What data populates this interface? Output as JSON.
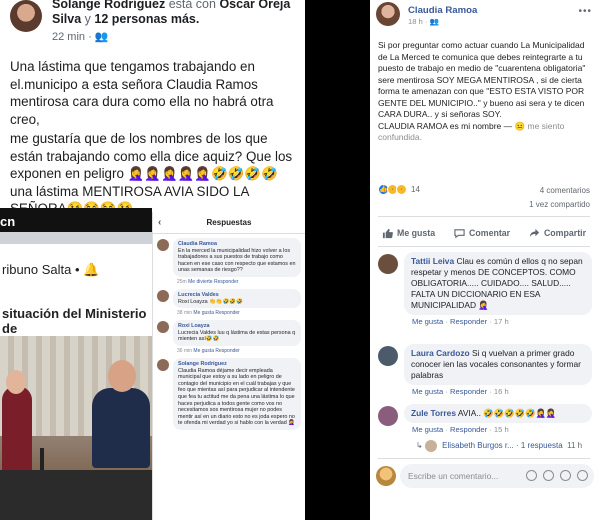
{
  "left_post": {
    "author_line": "Solange Rodríguez",
    "with_word": "está con",
    "tagged": "Oscar Oreja Silva",
    "and_word": "y",
    "others": "12 personas más.",
    "time": "22 min",
    "audience_icon": "friends-icon",
    "paragraph_1": "Una lástima que tengamos trabajando en el.municipo a esta señora Claudia Ramos mentirosa cara dura como ella no habrá otra creo,",
    "paragraph_2": " me gustaría que de los nombres de los que están trabajando como ella dice aquiz? Que los exponen en peligro 🤦‍♀️🤦‍♀️🤦‍♀️🤦‍♀️🤦‍♀️🤣🤣🤣🤣 una lástima MENTIROSA AVIA SIDO LA SEÑORA😘😂😂😘"
  },
  "news_image": {
    "logo": "cn",
    "outlet": "ribuno Salta • 🔔",
    "headline": "situación del Ministerio de"
  },
  "phone": {
    "title": "Respuestas",
    "comments": [
      {
        "name": "Claudia Ramoa",
        "text": "En la merced la municipalidad hizo volver a los trabajadores a sus puestos de trabajo como hacen en ese caso con respecto que estamos en unas semanas de riesgo??",
        "time": "25m",
        "like": "Me divierte",
        "reply": "Responder"
      },
      {
        "name": "Lucrecia Valdes",
        "text": "Roxi Loayza 👏👏🤣🤣🤣",
        "time": "38 min",
        "like": "Me gusta",
        "reply": "Responder"
      },
      {
        "name": "Roxi Loayza",
        "text": "Lucrecia Valdes luu q lástima de estas persona q mienten así🤣🤣",
        "time": "36 min",
        "like": "Me gusta",
        "reply": "Responder"
      },
      {
        "name": "Solange Rodríguez",
        "text": "Claudia Ramoa déjame decir empleada municipal que estoy a su lado en peligro de contagio del municipio en el cuál trabajas y que feo que mientas así para perjudicar al intendente que fea tu actitud me da pena una lástima lo que haces perjudica a todos gente como vos no necesitamos sos mentirosa mujer no podes mentir así en un diario esto no es joda espero no te ofenda mi verdad yo si hablo con la verdad 🤦‍♀️",
        "time": "",
        "like": "",
        "reply": ""
      }
    ]
  },
  "right_post": {
    "author": "Claudia Ramoa",
    "time": "18 h · 👥",
    "more_icon": "more-dots-icon",
    "body": "Si por preguntar como actuar cuando La Municipalidad de La Merced te comunica que debes reintegrarte a tu puesto de trabajo en medio de \"cuarentena obligatoria\" sere mentirosa SOY MEGA MENTIROSA , si de cierta forma te amenazan con que \"ESTO ESTA VISTO POR GENTE DEL MUNICIPIO..\" y bueno asi sera y te dicen CARA DURA.. y si señoras SOY.",
    "signature": "CLAUDIA RAMOA es mi nombre — 😐",
    "feeling": "me siento confundida.",
    "reactions_count": "14",
    "comments_count": "4 comentarios",
    "shares_count": "1 vez compartido",
    "actions": {
      "like": "Me gusta",
      "comment": "Comentar",
      "share": "Compartir"
    },
    "comments": [
      {
        "name": "Tattii Leiva",
        "text": "Clau es común d ellos q no sepan respetar y menos DE CONCEPTOS. COMO OBLIGATORIA..... CUIDADO.... SALUD..... FALTA UN DICCIONARIO EN ESA MUNICIPALIDAD 🤦‍♀️",
        "like": "Me gusta",
        "reply": "Responder",
        "time": "17 h"
      },
      {
        "name": "Laura Cardozo",
        "text": "Si q vuelvan a primer grado conocer ien las vocales consonantes y formar palabras",
        "like": "Me gusta",
        "reply": "Responder",
        "time": "16 h"
      },
      {
        "name": "Zule Torres",
        "text": "AVIA.. 🤣🤣🤣🤣🤣🤦‍♀️🤦‍♀️",
        "like": "Me gusta",
        "reply": "Responder",
        "time": "15 h"
      }
    ],
    "reply_preview": {
      "name": "Elisabeth Burgos r...",
      "count": "1 respuesta",
      "time": "11 h"
    },
    "write_placeholder": "Escribe un comentario..."
  }
}
